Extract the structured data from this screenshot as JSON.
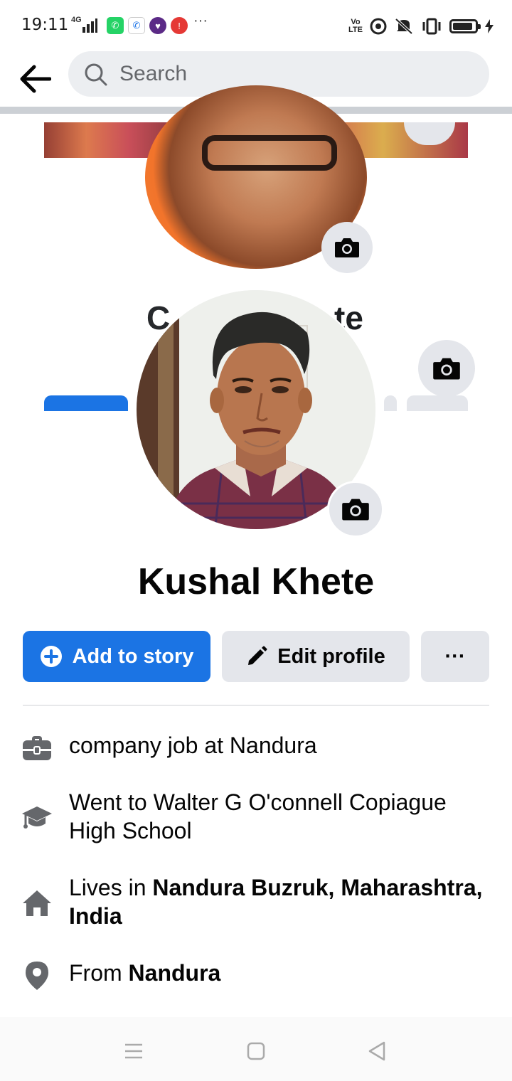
{
  "status_bar": {
    "time": "19:11",
    "network": "4G",
    "volte_top": "Vo",
    "volte_bottom": "LTE"
  },
  "search": {
    "placeholder": "Search"
  },
  "ghost": {
    "name_start": "C",
    "name_end": "te"
  },
  "profile": {
    "name": "Kushal Khete"
  },
  "actions": {
    "add_story": "Add to story",
    "edit_profile": "Edit profile",
    "more": "···"
  },
  "intro": {
    "work": "company job at Nandura",
    "education": "Went to Walter G O'connell Copiague High School",
    "lives_prefix": "Lives in ",
    "lives_place": "Nandura Buzruk, Maharashtra, India",
    "from_prefix": "From ",
    "from_place": "Nandura"
  },
  "colors": {
    "accent": "#1b74e4",
    "button_gray": "#e4e6eb",
    "icon_gray": "#65676b"
  }
}
